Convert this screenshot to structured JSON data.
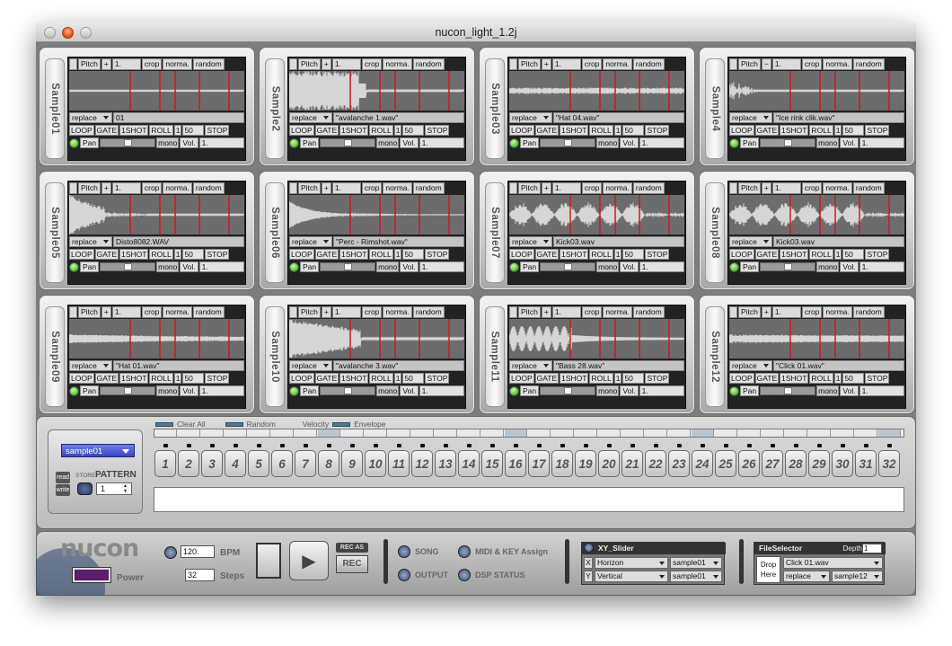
{
  "window": {
    "title": "nucon_light_1.2j"
  },
  "sample_common": {
    "pitch": "Pitch",
    "plus": "+",
    "crop": "crop",
    "norma": "norma.",
    "random": "random",
    "replace": "replace",
    "loop": "LOOP",
    "gate": "GATE",
    "oneshot": "1SHOT",
    "roll": "ROLL",
    "one": "1",
    "fifty": "50",
    "stop": "STOP",
    "pan": "Pan",
    "mono": "mono",
    "vol": "Vol.",
    "vol_value": "1."
  },
  "samples": [
    {
      "label": "Sample01",
      "sign": "+",
      "pitch_value": "1.",
      "file": "01",
      "wave": "flat"
    },
    {
      "label": "Sample2",
      "sign": "+",
      "pitch_value": "1.",
      "file": "\"avalanche 1.wav\"",
      "wave": "crash"
    },
    {
      "label": "Sample03",
      "sign": "+",
      "pitch_value": "1.",
      "file": "\"Hat 04.wav\"",
      "wave": "noise"
    },
    {
      "label": "Sample4",
      "sign": "−",
      "pitch_value": "1.",
      "file": "\"Ice rink clik.wav\"",
      "wave": "short"
    },
    {
      "label": "Sample05",
      "sign": "+",
      "pitch_value": "1.",
      "file": "Disto8082.WAV",
      "wave": "burst"
    },
    {
      "label": "Sample06",
      "sign": "+",
      "pitch_value": "1.",
      "file": "\"Perc - Rimshot.wav\"",
      "wave": "decay"
    },
    {
      "label": "Sample07",
      "sign": "+",
      "pitch_value": "1.",
      "file": "Kick03.wav",
      "wave": "pulses"
    },
    {
      "label": "Sample08",
      "sign": "+",
      "pitch_value": "1.",
      "file": "Kick03.wav",
      "wave": "pulses"
    },
    {
      "label": "Sample09",
      "sign": "+",
      "pitch_value": "1.",
      "file": "\"Hat 01.wav\"",
      "wave": "noise2"
    },
    {
      "label": "Sample10",
      "sign": "+",
      "pitch_value": "1.",
      "file": "\"avalanche 3.wav\"",
      "wave": "crash2"
    },
    {
      "label": "Sample11",
      "sign": "+",
      "pitch_value": "1.",
      "file": "\"Bass 28.wav\"",
      "wave": "bass"
    },
    {
      "label": "Sample12",
      "sign": "+",
      "pitch_value": "1.",
      "file": "\"Click 01.wav\"",
      "wave": "noise3"
    }
  ],
  "sequencer": {
    "clear_all": "Clear All",
    "random": "Random",
    "velocity": "Velocity",
    "envelope": "Envelope",
    "sample_select": "sample01",
    "read": "read",
    "write": "write",
    "store": "STORE",
    "pattern_label": "PATTERN",
    "pattern_value": "1",
    "steps": [
      "1",
      "2",
      "3",
      "4",
      "5",
      "6",
      "7",
      "8",
      "9",
      "10",
      "11",
      "12",
      "13",
      "14",
      "15",
      "16",
      "17",
      "18",
      "19",
      "20",
      "21",
      "22",
      "23",
      "24",
      "25",
      "26",
      "27",
      "28",
      "29",
      "30",
      "31",
      "32"
    ]
  },
  "transport": {
    "logo": "nucon",
    "power": "Power",
    "bpm_value": "120.",
    "bpm_label": "BPM",
    "steps_value": "32",
    "steps_label": "Steps",
    "rec_as": "REC AS",
    "rec": "REC",
    "song": "SONG",
    "output": "OUTPUT",
    "midi_key": "MIDI & KEY Assign",
    "dsp_status": "DSP STATUS"
  },
  "xy_slider": {
    "title": "XY_Slider",
    "x_axis": "X",
    "x_mode": "Horizon",
    "x_target": "sample01",
    "y_axis": "Y",
    "y_mode": "Vertical",
    "y_target": "sample01"
  },
  "file_selector": {
    "title": "FileSelector",
    "depth_label": "Depth",
    "depth_value": "1",
    "drop_here": "Drop Here",
    "file": "Click 01.wav",
    "mode": "replace",
    "target": "sample12"
  },
  "colors": {
    "accent": "#4a55cf",
    "led": "#6cc43a",
    "marker": "#d01818",
    "wave": "#d6d6d6"
  }
}
